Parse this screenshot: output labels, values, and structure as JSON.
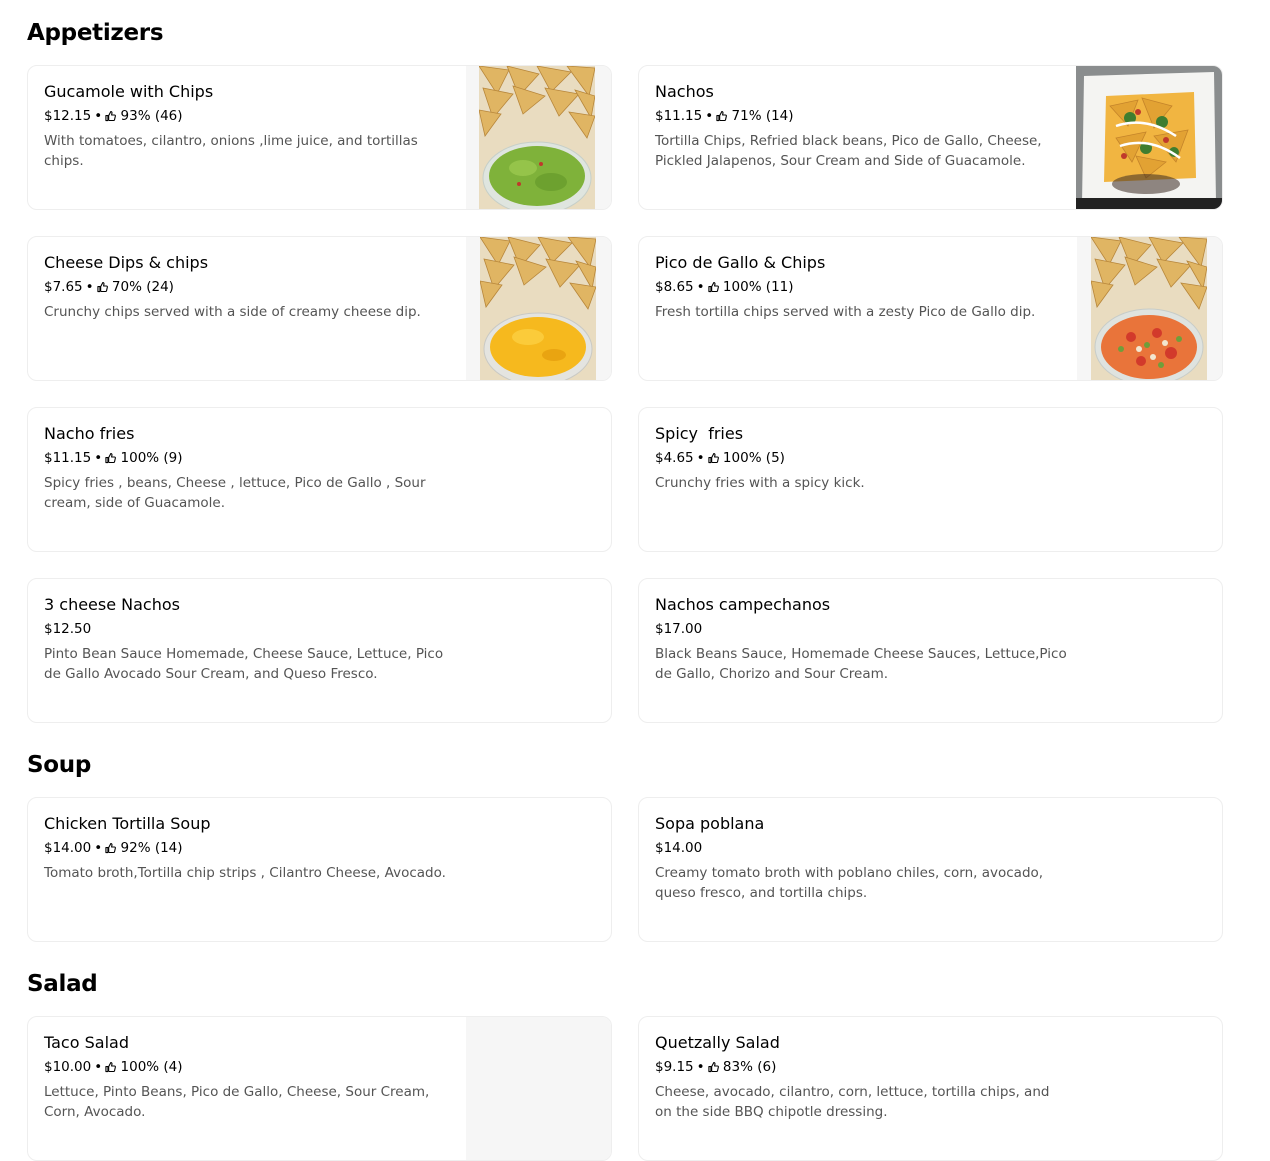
{
  "sections": [
    {
      "title": "Appetizers",
      "items": [
        {
          "name": "Gucamole with Chips",
          "price": "$12.15",
          "rating": "93% (46)",
          "desc": "With tomatoes, cilantro, onions ,lime juice, and tortillas chips.",
          "image": "guacamole-chips-photo"
        },
        {
          "name": "Nachos",
          "price": "$11.15",
          "rating": "71% (14)",
          "desc": "Tortilla Chips, Refried black beans, Pico de Gallo, Cheese, Pickled Jalapenos, Sour Cream and Side of Guacamole.",
          "image": "nachos-photo"
        },
        {
          "name": "Cheese Dips & chips",
          "price": "$7.65",
          "rating": "70% (24)",
          "desc": "Crunchy chips served with a side of creamy cheese dip.",
          "image": "cheese-dip-chips-photo"
        },
        {
          "name": "Pico de Gallo & Chips",
          "price": "$8.65",
          "rating": "100% (11)",
          "desc": "Fresh tortilla chips served with a zesty Pico de Gallo dip.",
          "image": "pico-de-gallo-chips-photo"
        },
        {
          "name": "Nacho fries",
          "price": "$11.15",
          "rating": "100% (9)",
          "desc": "Spicy fries , beans, Cheese , lettuce, Pico de Gallo , Sour cream, side of Guacamole."
        },
        {
          "name": "Spicy  fries",
          "price": "$4.65",
          "rating": "100% (5)",
          "desc": "Crunchy fries with a spicy kick."
        },
        {
          "name": "3 cheese Nachos",
          "price": "$12.50",
          "rating": "",
          "desc": "Pinto Bean Sauce Homemade, Cheese Sauce, Lettuce, Pico de Gallo Avocado Sour Cream, and Queso Fresco."
        },
        {
          "name": "Nachos campechanos",
          "price": "$17.00",
          "rating": "",
          "desc": "Black Beans Sauce, Homemade Cheese Sauces, Lettuce,Pico de Gallo, Chorizo and Sour Cream."
        }
      ]
    },
    {
      "title": "Soup",
      "items": [
        {
          "name": "Chicken Tortilla Soup",
          "price": "$14.00",
          "rating": "92% (14)",
          "desc": "Tomato broth,Tortilla chip strips , Cilantro Cheese, Avocado."
        },
        {
          "name": "Sopa poblana",
          "price": "$14.00",
          "rating": "",
          "desc": "Creamy tomato broth with poblano chiles, corn, avocado, queso fresco, and tortilla chips."
        }
      ]
    },
    {
      "title": "Salad",
      "items": [
        {
          "name": "Taco Salad",
          "price": "$10.00",
          "rating": "100% (4)",
          "desc": "Lettuce, Pinto Beans, Pico de Gallo, Cheese, Sour Cream, Corn, Avocado.",
          "image": "taco-salad-photo-placeholder"
        },
        {
          "name": "Quetzally Salad",
          "price": "$9.15",
          "rating": "83% (6)",
          "desc": "Cheese, avocado, cilantro, corn, lettuce, tortilla chips, and on the side BBQ chipotle dressing."
        }
      ]
    }
  ],
  "icons": {
    "rating": "thumbs-up-icon"
  },
  "colors": {
    "text": "#000000",
    "description": "#545454",
    "border": "#eeeeee",
    "placeholder": "#f6f6f6"
  }
}
